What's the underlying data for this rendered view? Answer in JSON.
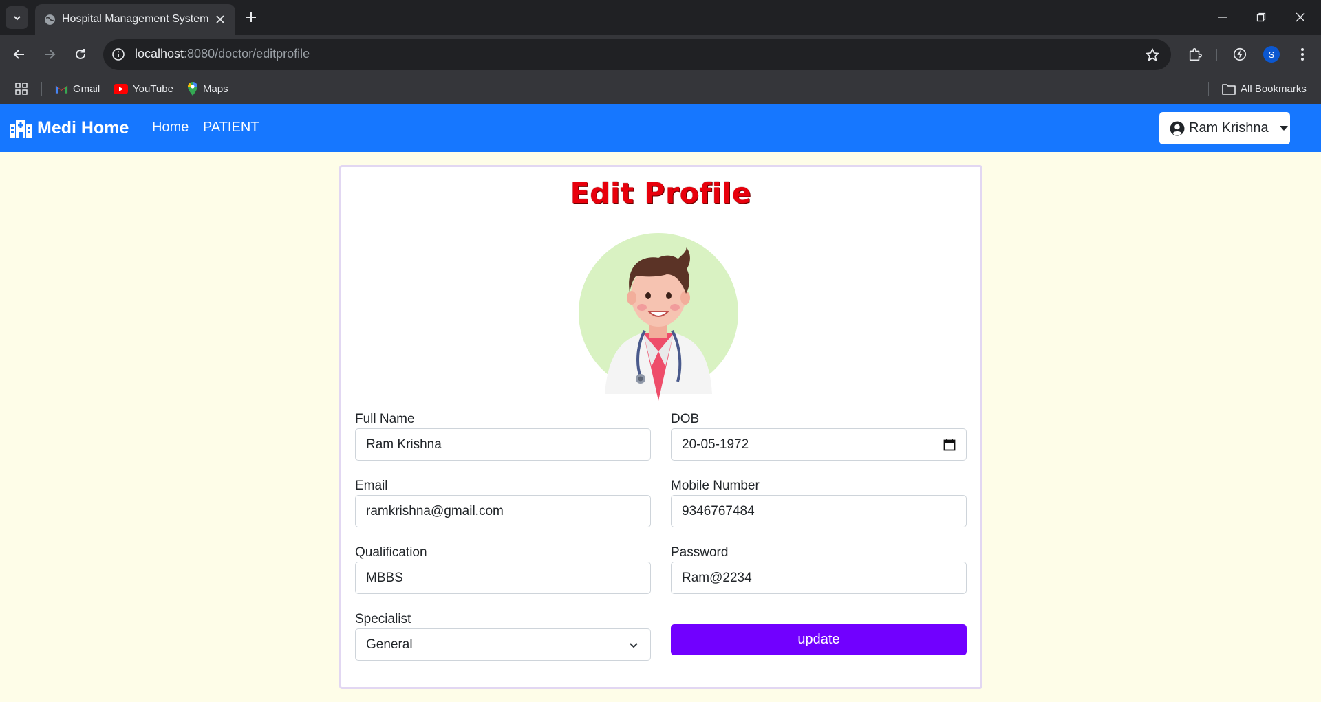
{
  "browser": {
    "tab_title": "Hospital Management System",
    "url_host": "localhost",
    "url_rest": ":8080/doctor/editprofile",
    "profile_initial": "S",
    "bookmarks": [
      {
        "label": "Gmail",
        "icon": "gmail-icon"
      },
      {
        "label": "YouTube",
        "icon": "youtube-icon"
      },
      {
        "label": "Maps",
        "icon": "maps-icon"
      }
    ],
    "all_bookmarks": "All Bookmarks"
  },
  "navbar": {
    "brand": "Medi Home",
    "links": [
      "Home",
      "PATIENT"
    ],
    "user_name": "Ram Krishna",
    "bg_color": "#1677ff"
  },
  "form": {
    "title": "Edit Profile",
    "fields": {
      "full_name": {
        "label": "Full Name",
        "value": "Ram Krishna"
      },
      "dob": {
        "label": "DOB",
        "value": "20-05-1972"
      },
      "email": {
        "label": "Email",
        "value": "ramkrishna@gmail.com"
      },
      "mobile": {
        "label": "Mobile Number",
        "value": "9346767484"
      },
      "qualification": {
        "label": "Qualification",
        "value": "MBBS"
      },
      "password": {
        "label": "Password",
        "value": "Ram@2234"
      },
      "specialist": {
        "label": "Specialist",
        "value": "General"
      }
    },
    "submit_label": "update",
    "submit_color": "#7100ff",
    "title_color": "#e8000c"
  }
}
